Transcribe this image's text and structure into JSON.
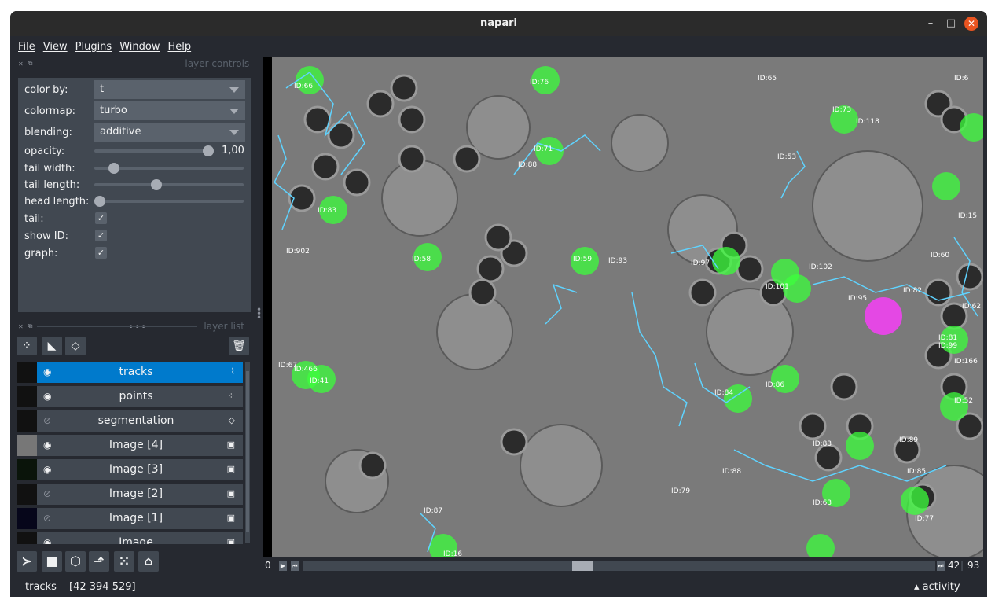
{
  "app": {
    "title": "napari"
  },
  "menu": [
    "File",
    "View",
    "Plugins",
    "Window",
    "Help"
  ],
  "layer_controls": {
    "header": "layer controls",
    "color_by": {
      "label": "color by:",
      "value": "t"
    },
    "colormap": {
      "label": "colormap:",
      "value": "turbo"
    },
    "blending": {
      "label": "blending:",
      "value": "additive"
    },
    "opacity": {
      "label": "opacity:",
      "value": 1.0,
      "value_text": "1,00"
    },
    "tail_width": {
      "label": "tail width:",
      "value": 0.1
    },
    "tail_length": {
      "label": "tail length:",
      "value": 0.41
    },
    "head_length": {
      "label": "head length:",
      "value": 0.0
    },
    "tail": {
      "label": "tail:",
      "checked": true
    },
    "show_id": {
      "label": "show ID:",
      "checked": true
    },
    "graph": {
      "label": "graph:",
      "checked": true
    }
  },
  "layer_list": {
    "header": "layer list",
    "layers": [
      {
        "name": "tracks",
        "visible": true,
        "selected": true,
        "type_icon": "tracks-icon"
      },
      {
        "name": "points",
        "visible": true,
        "selected": false,
        "type_icon": "points-icon"
      },
      {
        "name": "segmentation",
        "visible": false,
        "selected": false,
        "type_icon": "labels-icon"
      },
      {
        "name": "Image [4]",
        "visible": true,
        "selected": false,
        "type_icon": "image-icon"
      },
      {
        "name": "Image [3]",
        "visible": true,
        "selected": false,
        "type_icon": "image-icon"
      },
      {
        "name": "Image [2]",
        "visible": false,
        "selected": false,
        "type_icon": "image-icon"
      },
      {
        "name": "Image [1]",
        "visible": false,
        "selected": false,
        "type_icon": "image-icon"
      },
      {
        "name": "Image",
        "visible": true,
        "selected": false,
        "type_icon": "image-icon"
      }
    ]
  },
  "canvas": {
    "track_labels": [
      "ID:66",
      "ID:76",
      "ID:6",
      "ID:73",
      "ID:118",
      "ID:71",
      "ID:88",
      "ID:53",
      "ID:83",
      "ID:65",
      "ID:902",
      "ID:58",
      "ID:59",
      "ID:93",
      "ID:97",
      "ID:102",
      "ID:101",
      "ID:95",
      "ID:82",
      "ID:60",
      "ID:15",
      "ID:62",
      "ID:81",
      "ID:166",
      "ID:466",
      "ID:67",
      "ID:41",
      "ID:84",
      "ID:86",
      "ID:89",
      "ID:85",
      "ID:88",
      "ID:63",
      "ID:77",
      "ID:79",
      "ID:87",
      "ID:99",
      "ID:83",
      "ID:16",
      "ID:52"
    ]
  },
  "dims": {
    "current": 42,
    "total": 93,
    "start_label": "0",
    "position": 0.44
  },
  "status": {
    "text": "tracks",
    "coords": "[42 394 529]",
    "activity": "activity"
  },
  "colors": {
    "accent": "#007acc",
    "background": "#262930",
    "panel": "#414851",
    "track": "#5fd3ff",
    "points": "#3cff3c",
    "highlight": "#ff3cff"
  }
}
